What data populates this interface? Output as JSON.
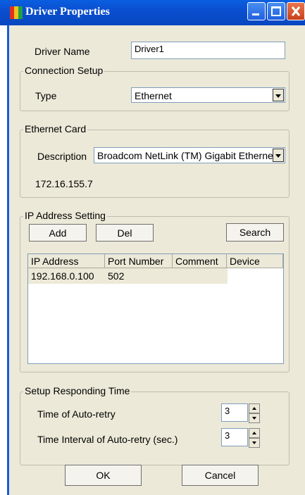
{
  "window": {
    "title": "Driver Properties"
  },
  "driver": {
    "name_label": "Driver Name",
    "name_value": "Driver1"
  },
  "connection": {
    "group_title": "Connection Setup",
    "type_label": "Type",
    "type_value": "Ethernet"
  },
  "ethernet": {
    "group_title": "Ethernet Card",
    "description_label": "Description",
    "description_value": "Broadcom NetLink (TM) Gigabit Etherne",
    "ip": "172.16.155.7"
  },
  "ip_setting": {
    "group_title": "IP Address Setting",
    "add_label": "Add",
    "del_label": "Del",
    "search_label": "Search",
    "columns": [
      "IP Address",
      "Port Number",
      "Comment",
      "Device"
    ],
    "rows": [
      {
        "ip": "192.168.0.100",
        "port": "502",
        "comment": "",
        "device": ""
      }
    ]
  },
  "responding": {
    "group_title": "Setup Responding Time",
    "retry_label": "Time of Auto-retry",
    "retry_value": "3",
    "interval_label": "Time Interval of Auto-retry (sec.)",
    "interval_value": "3"
  },
  "footer": {
    "ok_label": "OK",
    "cancel_label": "Cancel"
  },
  "colors": {
    "title_bar": "#0a4fd0",
    "dialog_bg": "#ece9d8",
    "selected_row": "#ece9d8"
  }
}
